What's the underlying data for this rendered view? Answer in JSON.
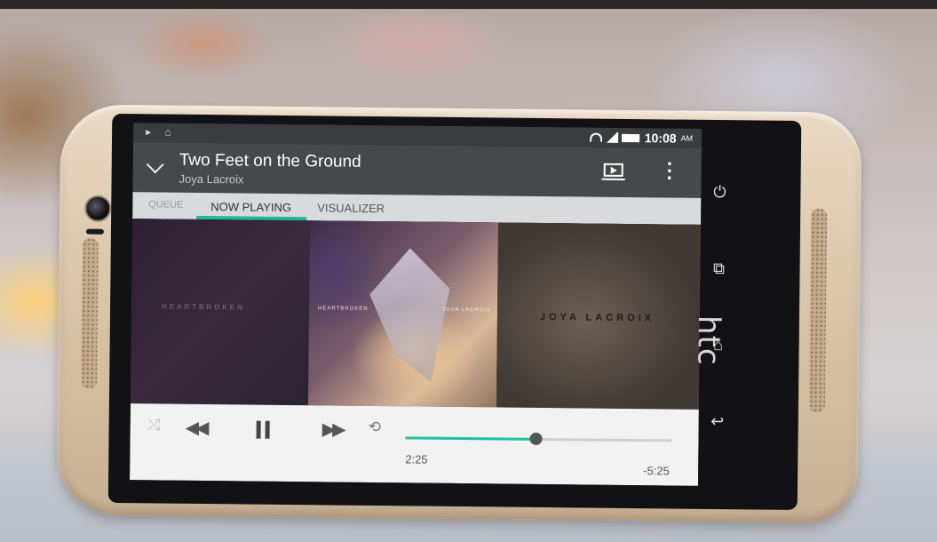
{
  "status_bar": {
    "time": "10:08",
    "ampm": "AM"
  },
  "header": {
    "title": "Two Feet on the Ground",
    "artist": "Joya Lacroix"
  },
  "tabs": [
    {
      "label": "QUEUE"
    },
    {
      "label": "NOW PLAYING",
      "active": true
    },
    {
      "label": "VISUALIZER"
    }
  ],
  "album_art": {
    "left_text": "HEARTBROKEN",
    "center_left_text": "HEARTBROKEN",
    "center_right_text": "JOYA LACROIX",
    "right_text": "JOYA LACROIX"
  },
  "playback": {
    "elapsed": "2:25",
    "remaining": "-5:25",
    "progress_fraction": 0.49,
    "state": "playing",
    "accent_color": "#1fc2a0"
  },
  "icons": [
    "chevron-down-icon",
    "cast-icon",
    "more-icon",
    "shuffle-icon",
    "rewind-icon",
    "pause-icon",
    "fast-forward-icon",
    "repeat-icon",
    "power-icon",
    "recent-apps-icon",
    "home-icon",
    "back-icon"
  ],
  "brand": {
    "logo_text": "htc"
  }
}
